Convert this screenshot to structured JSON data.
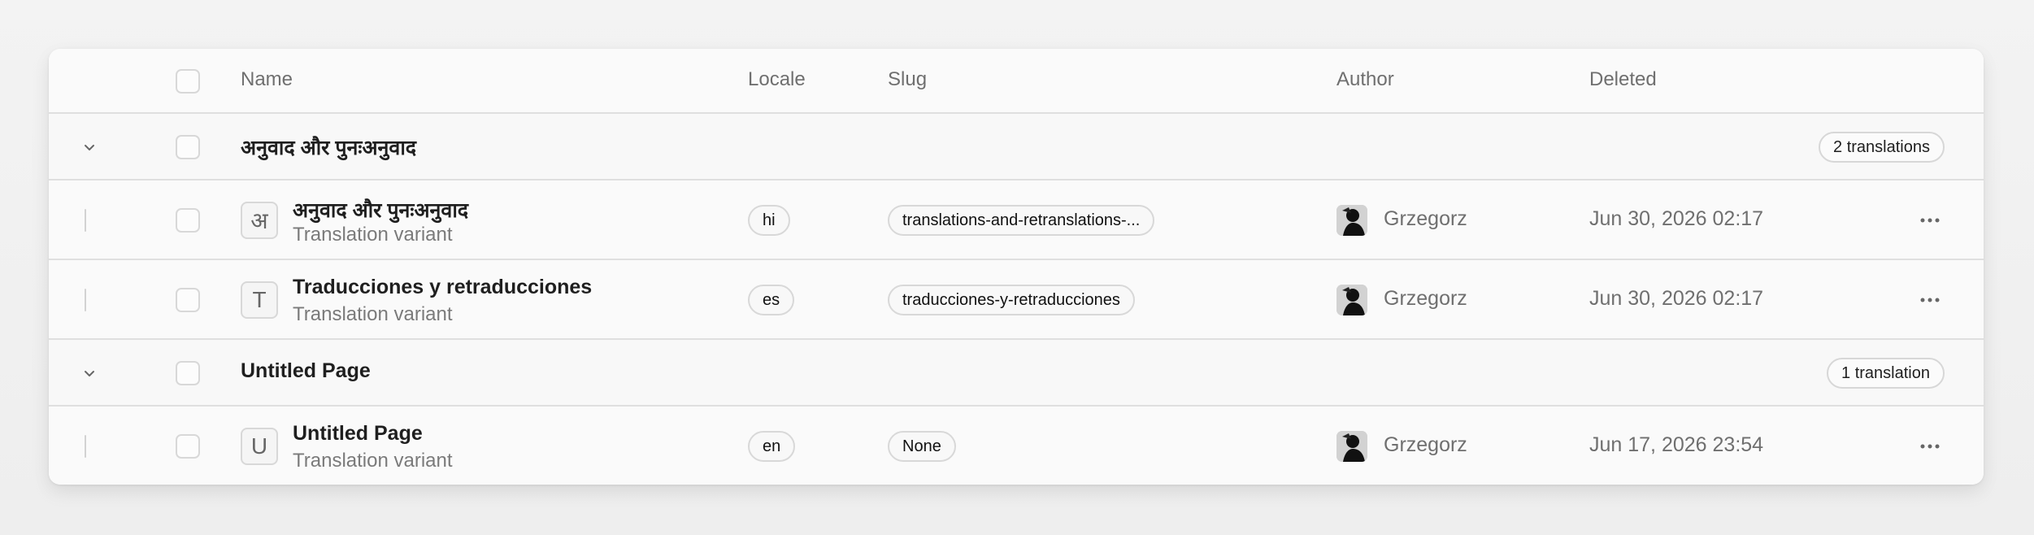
{
  "table": {
    "headers": {
      "name": "Name",
      "locale": "Locale",
      "slug": "Slug",
      "author": "Author",
      "deleted": "Deleted"
    },
    "groups": [
      {
        "title": "अनुवाद और पुनःअनुवाद",
        "count_label": "2 translations",
        "items": [
          {
            "letter": "अ",
            "title": "अनुवाद और पुनःअनुवाद",
            "subtitle": "Translation variant",
            "locale": "hi",
            "slug": "translations-and-retranslations-...",
            "author": "Grzegorz",
            "deleted": "Jun 30, 2026 02:17"
          },
          {
            "letter": "T",
            "title": "Traducciones y retraducciones",
            "subtitle": "Translation variant",
            "locale": "es",
            "slug": "traducciones-y-retraducciones",
            "author": "Grzegorz",
            "deleted": "Jun 30, 2026 02:17"
          }
        ]
      },
      {
        "title": "Untitled Page",
        "count_label": "1 translation",
        "items": [
          {
            "letter": "U",
            "title": "Untitled Page",
            "subtitle": "Translation variant",
            "locale": "en",
            "slug": "None",
            "author": "Grzegorz",
            "deleted": "Jun 17, 2026 23:54"
          }
        ]
      }
    ]
  },
  "icons": {
    "expand": "chevron-down-icon",
    "actions": "more-horizontal-icon",
    "avatar": "user-avatar"
  },
  "colors": {
    "border": "#dfdfdf",
    "muted_text": "#6f6f6f",
    "surface": "#fafafa"
  }
}
